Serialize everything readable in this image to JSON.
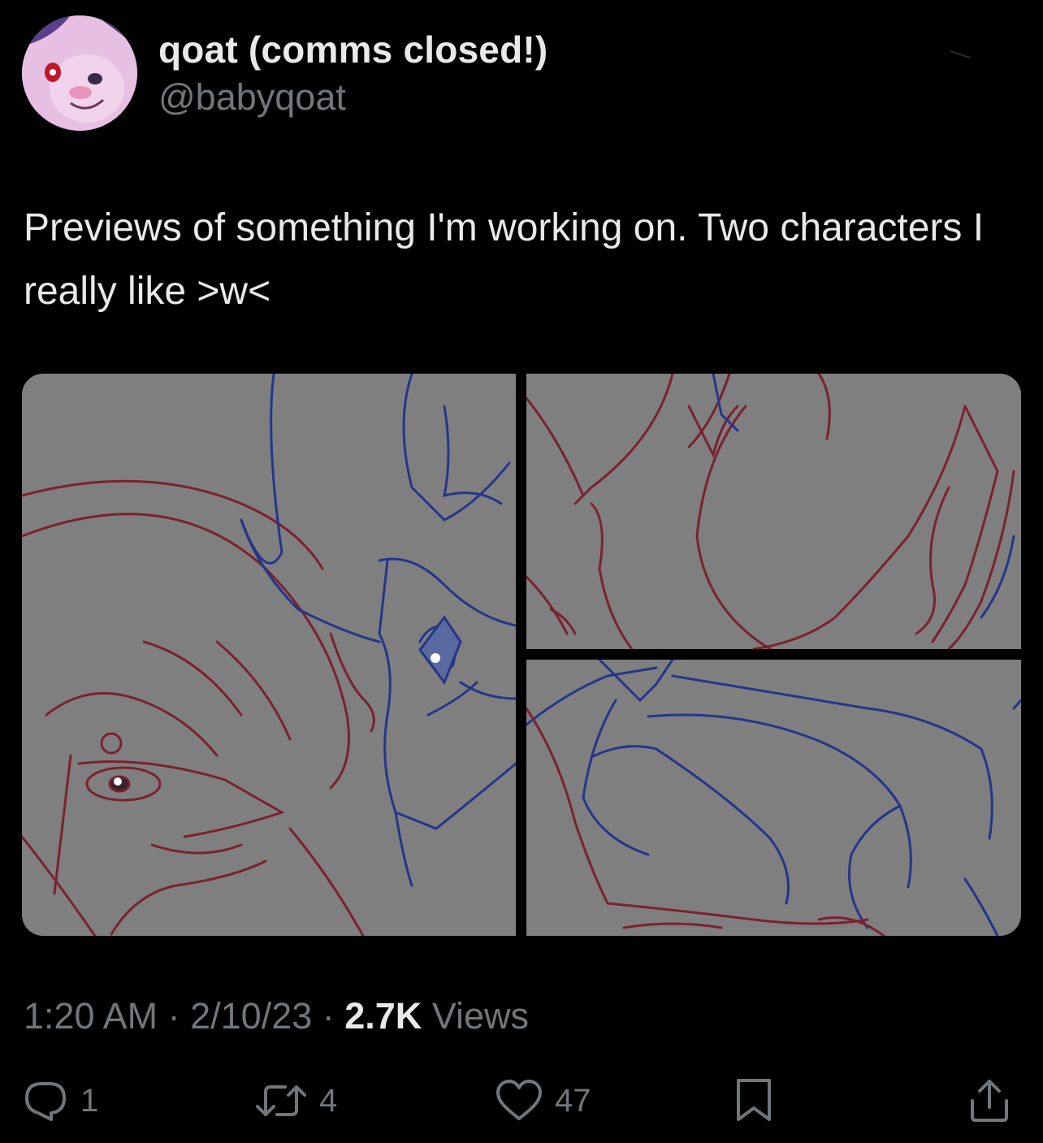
{
  "author": {
    "display_name": "qoat (comms closed!)",
    "handle": "@babyqoat"
  },
  "tweet": {
    "text": "Previews of something I'm working on. Two characters I really like >w<"
  },
  "meta": {
    "time": "1:20 AM",
    "separator1": " · ",
    "date": "2/10/23",
    "separator2": " · ",
    "views_count": "2.7K",
    "views_label": " Views"
  },
  "actions": {
    "replies": "1",
    "retweets": "4",
    "likes": "47"
  },
  "icons": {
    "reply": "reply-icon",
    "retweet": "retweet-icon",
    "like": "heart-icon",
    "bookmark": "bookmark-icon",
    "share": "share-icon"
  },
  "colors": {
    "background": "#000000",
    "primary_text": "#e7e9ea",
    "secondary_text": "#71767b",
    "panel_gray": "#7f7f7f",
    "sketch_red": "#7a2230",
    "sketch_blue": "#24368a"
  }
}
